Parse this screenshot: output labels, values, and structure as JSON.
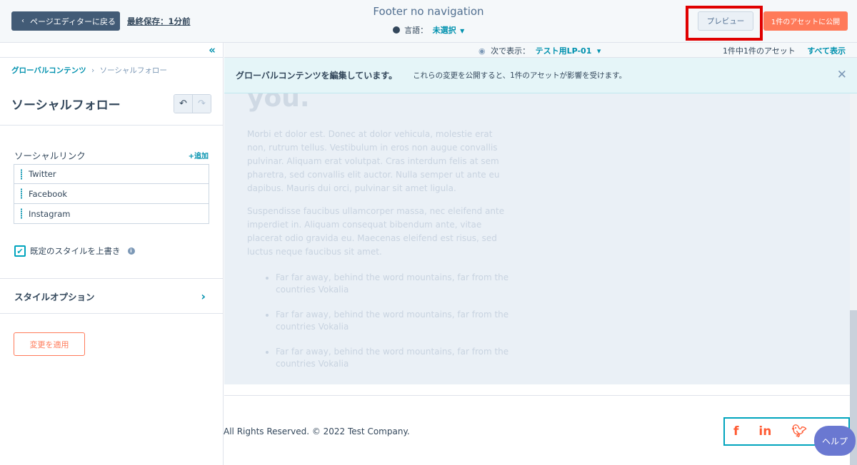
{
  "topbar": {
    "back_label": "ページエディターに戻る",
    "last_saved": "最終保存：1分前",
    "page_title": "Footer no navigation",
    "language_label": "言語：",
    "language_value": "未選択",
    "preview_label": "プレビュー",
    "publish_label": "1件のアセットに公開"
  },
  "sidebar": {
    "breadcrumb": {
      "root": "グローバルコンテンツ",
      "current": "ソーシャルフォロー"
    },
    "module_title": "ソーシャルフォロー",
    "links_label": "ソーシャルリンク",
    "add_label": "+追加",
    "links": [
      "Twitter",
      "Facebook",
      "Instagram"
    ],
    "override_label": "既定のスタイルを上書き",
    "style_options_label": "スタイルオプション",
    "apply_label": "変更を適用"
  },
  "canvas": {
    "view_next_label": "次で表示：",
    "view_next_value": "テスト用LP-01",
    "asset_count": "1件中1件のアセット",
    "show_all": "すべて表示",
    "banner_bold": "グローバルコンテンツを編集しています。",
    "banner_msg": "これらの変更を公開すると、1件のアセットが影響を受けます。",
    "faded_heading": "you.",
    "para1": "Morbi et dolor est. Donec at dolor vehicula, molestie erat non, rutrum tellus. Vestibulum in eros non augue convallis pulvinar. Aliquam erat volutpat. Cras interdum felis at sem pharetra, sed convallis elit auctor. Nulla semper ut ante eu dapibus. Mauris dui orci, pulvinar sit amet ligula.",
    "para2": "Suspendisse faucibus ullamcorper massa, nec eleifend ante imperdiet in. Aliquam consequat bibendum ante, vitae placerat odio gravida eu. Maecenas eleifend est risus, sed luctus neque faucibus sit amet.",
    "bullets": [
      "Far far away, behind the word mountains, far from the countries Vokalia",
      "Far far away, behind the word mountains, far from the countries Vokalia",
      "Far far away, behind the word mountains, far from the countries Vokalia"
    ],
    "copyright": "All Rights Reserved. © 2022 Test Company.",
    "social_icons": [
      "f",
      "in",
      "❧"
    ],
    "help_label": "ヘルプ"
  },
  "colors": {
    "accent": "#0091ae",
    "primary": "#ff7a59",
    "highlight": "#e00000"
  }
}
